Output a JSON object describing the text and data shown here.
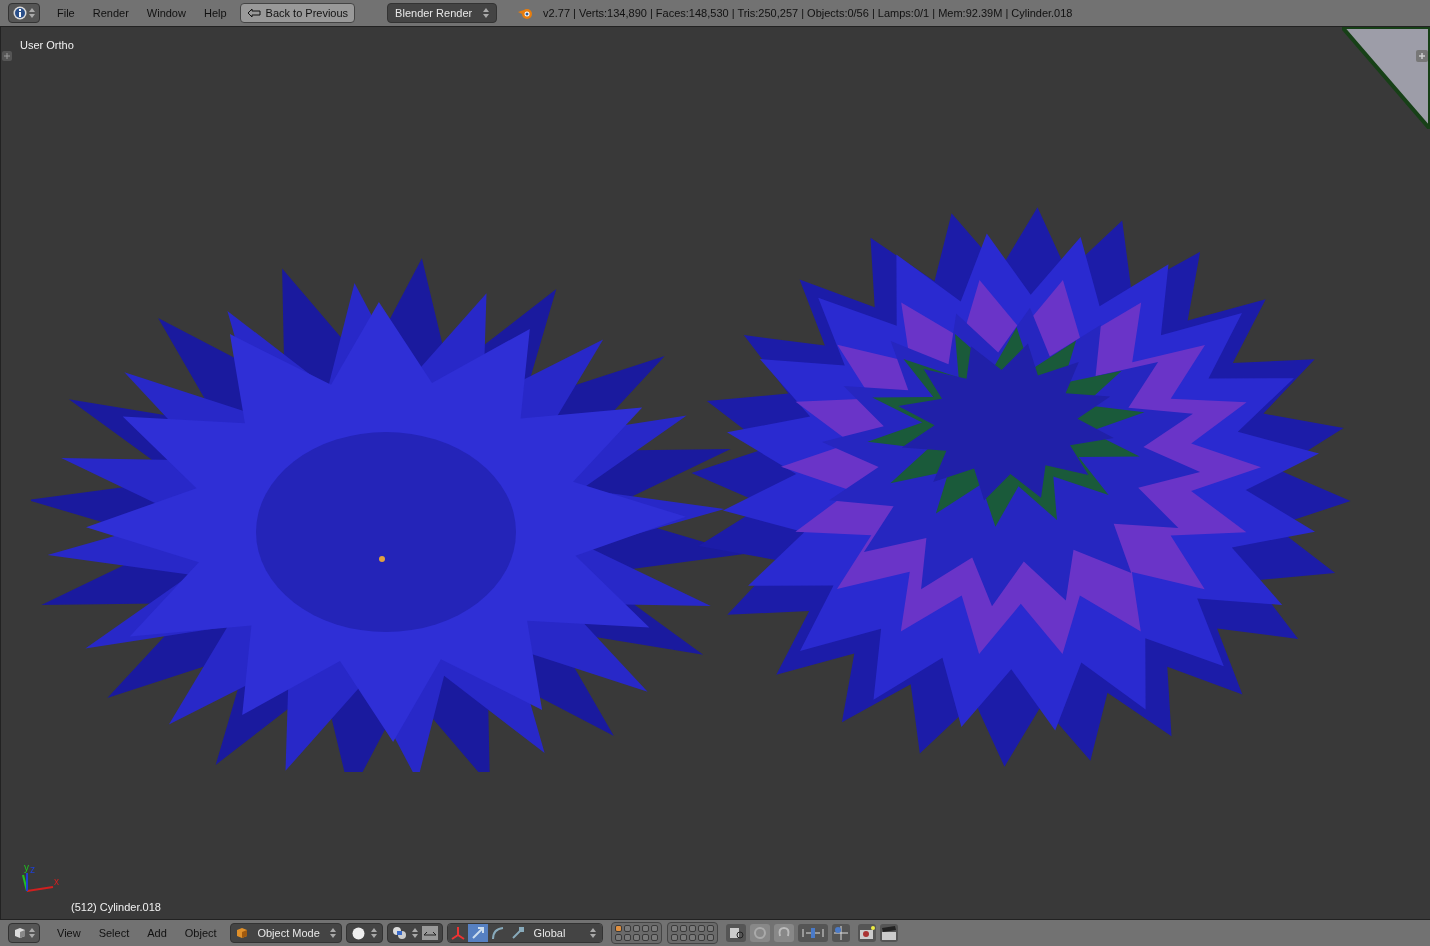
{
  "top_bar": {
    "menus": [
      "File",
      "Render",
      "Window",
      "Help"
    ],
    "back_button": "Back to Previous",
    "engine": "Blender Render",
    "stats": "v2.77 | Verts:134,890 | Faces:148,530 | Tris:250,257 | Objects:0/56 | Lamps:0/1 | Mem:92.39M | Cylinder.018"
  },
  "viewport": {
    "view_name": "User Ortho",
    "object_info": "(512) Cylinder.018",
    "axes": [
      "x",
      "y",
      "z"
    ]
  },
  "bottom_bar": {
    "menus": [
      "View",
      "Select",
      "Add",
      "Object"
    ],
    "mode": "Object Mode",
    "orientation": "Global",
    "manipulators": [
      {
        "kind": "axes",
        "selected": false
      },
      {
        "kind": "translate",
        "selected": true
      },
      {
        "kind": "rotate",
        "selected": false
      },
      {
        "kind": "scale",
        "selected": false
      }
    ],
    "layers": [
      {
        "selected": true
      },
      {
        "selected": false
      },
      {
        "selected": false
      },
      {
        "selected": false
      },
      {
        "selected": false
      },
      {
        "selected": false
      },
      {
        "selected": false
      },
      {
        "selected": false
      },
      {
        "selected": false
      },
      {
        "selected": false
      },
      {
        "selected": false
      },
      {
        "selected": false
      },
      {
        "selected": false
      },
      {
        "selected": false
      },
      {
        "selected": false
      },
      {
        "selected": false
      },
      {
        "selected": false
      },
      {
        "selected": false
      },
      {
        "selected": false
      },
      {
        "selected": false
      }
    ]
  }
}
